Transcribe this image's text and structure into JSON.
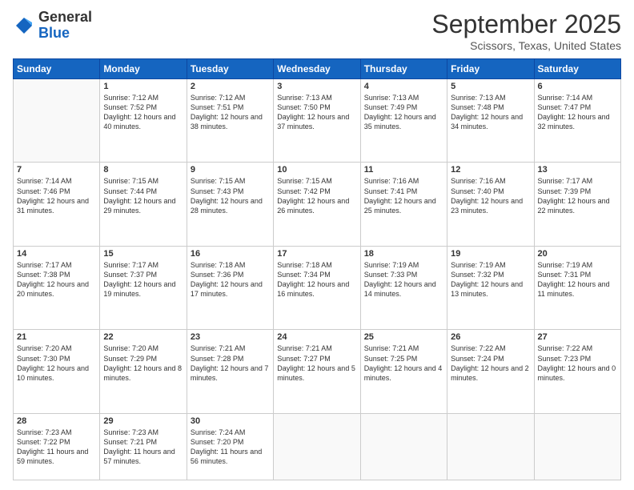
{
  "logo": {
    "general": "General",
    "blue": "Blue"
  },
  "header": {
    "month": "September 2025",
    "location": "Scissors, Texas, United States"
  },
  "weekdays": [
    "Sunday",
    "Monday",
    "Tuesday",
    "Wednesday",
    "Thursday",
    "Friday",
    "Saturday"
  ],
  "weeks": [
    [
      {
        "day": "",
        "sunrise": "",
        "sunset": "",
        "daylight": ""
      },
      {
        "day": "1",
        "sunrise": "Sunrise: 7:12 AM",
        "sunset": "Sunset: 7:52 PM",
        "daylight": "Daylight: 12 hours and 40 minutes."
      },
      {
        "day": "2",
        "sunrise": "Sunrise: 7:12 AM",
        "sunset": "Sunset: 7:51 PM",
        "daylight": "Daylight: 12 hours and 38 minutes."
      },
      {
        "day": "3",
        "sunrise": "Sunrise: 7:13 AM",
        "sunset": "Sunset: 7:50 PM",
        "daylight": "Daylight: 12 hours and 37 minutes."
      },
      {
        "day": "4",
        "sunrise": "Sunrise: 7:13 AM",
        "sunset": "Sunset: 7:49 PM",
        "daylight": "Daylight: 12 hours and 35 minutes."
      },
      {
        "day": "5",
        "sunrise": "Sunrise: 7:13 AM",
        "sunset": "Sunset: 7:48 PM",
        "daylight": "Daylight: 12 hours and 34 minutes."
      },
      {
        "day": "6",
        "sunrise": "Sunrise: 7:14 AM",
        "sunset": "Sunset: 7:47 PM",
        "daylight": "Daylight: 12 hours and 32 minutes."
      }
    ],
    [
      {
        "day": "7",
        "sunrise": "Sunrise: 7:14 AM",
        "sunset": "Sunset: 7:46 PM",
        "daylight": "Daylight: 12 hours and 31 minutes."
      },
      {
        "day": "8",
        "sunrise": "Sunrise: 7:15 AM",
        "sunset": "Sunset: 7:44 PM",
        "daylight": "Daylight: 12 hours and 29 minutes."
      },
      {
        "day": "9",
        "sunrise": "Sunrise: 7:15 AM",
        "sunset": "Sunset: 7:43 PM",
        "daylight": "Daylight: 12 hours and 28 minutes."
      },
      {
        "day": "10",
        "sunrise": "Sunrise: 7:15 AM",
        "sunset": "Sunset: 7:42 PM",
        "daylight": "Daylight: 12 hours and 26 minutes."
      },
      {
        "day": "11",
        "sunrise": "Sunrise: 7:16 AM",
        "sunset": "Sunset: 7:41 PM",
        "daylight": "Daylight: 12 hours and 25 minutes."
      },
      {
        "day": "12",
        "sunrise": "Sunrise: 7:16 AM",
        "sunset": "Sunset: 7:40 PM",
        "daylight": "Daylight: 12 hours and 23 minutes."
      },
      {
        "day": "13",
        "sunrise": "Sunrise: 7:17 AM",
        "sunset": "Sunset: 7:39 PM",
        "daylight": "Daylight: 12 hours and 22 minutes."
      }
    ],
    [
      {
        "day": "14",
        "sunrise": "Sunrise: 7:17 AM",
        "sunset": "Sunset: 7:38 PM",
        "daylight": "Daylight: 12 hours and 20 minutes."
      },
      {
        "day": "15",
        "sunrise": "Sunrise: 7:17 AM",
        "sunset": "Sunset: 7:37 PM",
        "daylight": "Daylight: 12 hours and 19 minutes."
      },
      {
        "day": "16",
        "sunrise": "Sunrise: 7:18 AM",
        "sunset": "Sunset: 7:36 PM",
        "daylight": "Daylight: 12 hours and 17 minutes."
      },
      {
        "day": "17",
        "sunrise": "Sunrise: 7:18 AM",
        "sunset": "Sunset: 7:34 PM",
        "daylight": "Daylight: 12 hours and 16 minutes."
      },
      {
        "day": "18",
        "sunrise": "Sunrise: 7:19 AM",
        "sunset": "Sunset: 7:33 PM",
        "daylight": "Daylight: 12 hours and 14 minutes."
      },
      {
        "day": "19",
        "sunrise": "Sunrise: 7:19 AM",
        "sunset": "Sunset: 7:32 PM",
        "daylight": "Daylight: 12 hours and 13 minutes."
      },
      {
        "day": "20",
        "sunrise": "Sunrise: 7:19 AM",
        "sunset": "Sunset: 7:31 PM",
        "daylight": "Daylight: 12 hours and 11 minutes."
      }
    ],
    [
      {
        "day": "21",
        "sunrise": "Sunrise: 7:20 AM",
        "sunset": "Sunset: 7:30 PM",
        "daylight": "Daylight: 12 hours and 10 minutes."
      },
      {
        "day": "22",
        "sunrise": "Sunrise: 7:20 AM",
        "sunset": "Sunset: 7:29 PM",
        "daylight": "Daylight: 12 hours and 8 minutes."
      },
      {
        "day": "23",
        "sunrise": "Sunrise: 7:21 AM",
        "sunset": "Sunset: 7:28 PM",
        "daylight": "Daylight: 12 hours and 7 minutes."
      },
      {
        "day": "24",
        "sunrise": "Sunrise: 7:21 AM",
        "sunset": "Sunset: 7:27 PM",
        "daylight": "Daylight: 12 hours and 5 minutes."
      },
      {
        "day": "25",
        "sunrise": "Sunrise: 7:21 AM",
        "sunset": "Sunset: 7:25 PM",
        "daylight": "Daylight: 12 hours and 4 minutes."
      },
      {
        "day": "26",
        "sunrise": "Sunrise: 7:22 AM",
        "sunset": "Sunset: 7:24 PM",
        "daylight": "Daylight: 12 hours and 2 minutes."
      },
      {
        "day": "27",
        "sunrise": "Sunrise: 7:22 AM",
        "sunset": "Sunset: 7:23 PM",
        "daylight": "Daylight: 12 hours and 0 minutes."
      }
    ],
    [
      {
        "day": "28",
        "sunrise": "Sunrise: 7:23 AM",
        "sunset": "Sunset: 7:22 PM",
        "daylight": "Daylight: 11 hours and 59 minutes."
      },
      {
        "day": "29",
        "sunrise": "Sunrise: 7:23 AM",
        "sunset": "Sunset: 7:21 PM",
        "daylight": "Daylight: 11 hours and 57 minutes."
      },
      {
        "day": "30",
        "sunrise": "Sunrise: 7:24 AM",
        "sunset": "Sunset: 7:20 PM",
        "daylight": "Daylight: 11 hours and 56 minutes."
      },
      {
        "day": "",
        "sunrise": "",
        "sunset": "",
        "daylight": ""
      },
      {
        "day": "",
        "sunrise": "",
        "sunset": "",
        "daylight": ""
      },
      {
        "day": "",
        "sunrise": "",
        "sunset": "",
        "daylight": ""
      },
      {
        "day": "",
        "sunrise": "",
        "sunset": "",
        "daylight": ""
      }
    ]
  ]
}
